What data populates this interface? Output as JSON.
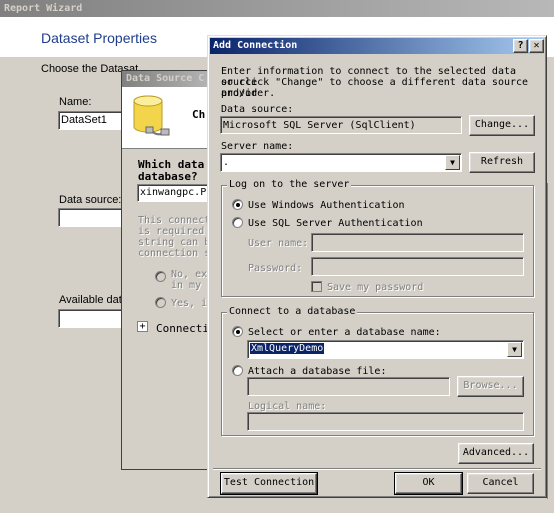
{
  "wizard": {
    "title": "Report Wizard",
    "heading": "Dataset Properties",
    "subheading": "Choose the Datasat",
    "name_label": "Name:",
    "name_value": "DataSet1",
    "datasource_label": "Data source:",
    "available_label": "Available data"
  },
  "dsc": {
    "title": "Data Source C",
    "header_title": "Ch",
    "which_line1": "Which data",
    "which_line2": "database?",
    "server_value": "xinwangpc.Pho",
    "desc": [
      "This connecti",
      "is required t",
      "string can be",
      "connection st"
    ],
    "opt1": [
      "No, exc",
      "in my e"
    ],
    "opt2": "Yes, in",
    "connection_label": "Connection"
  },
  "add": {
    "title": "Add Connection",
    "help": "?",
    "close": "✕",
    "intro": [
      "Enter information to connect to the selected data source",
      "or click \"Change\" to choose a different data source and/or",
      "provider."
    ],
    "datasource_label": "Data source:",
    "datasource_value": "Microsoft SQL Server (SqlClient)",
    "change_button": "Change...",
    "server_label": "Server name:",
    "server_value": ".",
    "refresh_button": "Refresh",
    "logon_legend": "Log on to the server",
    "windows_auth": "Use Windows Authentication",
    "sql_auth": "Use SQL Server Authentication",
    "user_label": "User name:",
    "password_label": "Password:",
    "save_password": "Save my password",
    "connect_legend": "Connect to a database",
    "select_db": "Select or enter a database name:",
    "db_value": "XmlQueryDemo",
    "attach_db": "Attach a database file:",
    "browse_button": "Browse...",
    "logical_label": "Logical name:",
    "advanced_button": "Advanced...",
    "test_button": "Test Connection",
    "ok_button": "OK",
    "cancel_button": "Cancel"
  }
}
